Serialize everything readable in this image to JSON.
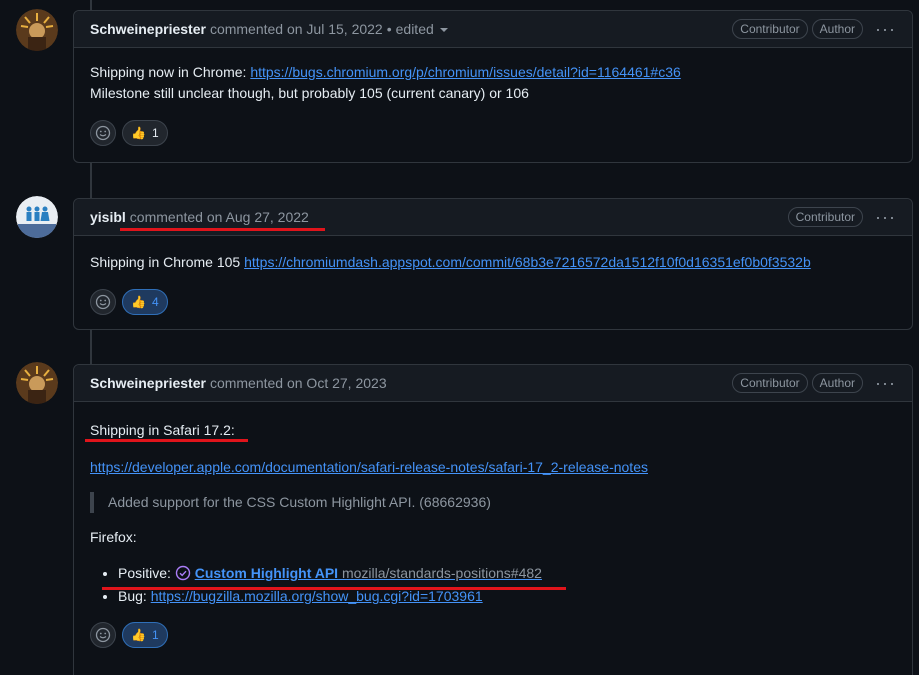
{
  "comments": [
    {
      "author": "Schweinepriester",
      "action": "commented on Jul 15, 2022",
      "edited": "edited",
      "labels": [
        "Contributor",
        "Author"
      ],
      "lines": [
        {
          "text": "Shipping now in Chrome: ",
          "link": "https://bugs.chromium.org/p/chromium/issues/detail?id=1164461#c36"
        },
        {
          "text": "Milestone still unclear though, but probably 105 (current canary) or 106"
        }
      ],
      "reaction": {
        "emoji": "👍",
        "count": "1"
      }
    },
    {
      "author": "yisibl",
      "action": "commented on Aug 27, 2022",
      "labels": [
        "Contributor"
      ],
      "lines": [
        {
          "text": "Shipping in Chrome 105 ",
          "link": "https://chromiumdash.appspot.com/commit/68b3e7216572da1512f10f0d16351ef0b0f3532b"
        }
      ],
      "reaction": {
        "emoji": "👍",
        "count": "4"
      }
    },
    {
      "author": "Schweinepriester",
      "action": "commented on Oct 27, 2023",
      "labels": [
        "Contributor",
        "Author"
      ],
      "heading": "Shipping in Safari 17.2:",
      "link": "https://developer.apple.com/documentation/safari-release-notes/safari-17_2-release-notes",
      "quote": "Added support for the CSS Custom Highlight API. (68662936)",
      "firefox_label": "Firefox:",
      "items": [
        {
          "prefix": "Positive: ",
          "link_bold": "Custom Highlight API",
          "link_rest": " mozilla/standards-positions#482"
        },
        {
          "prefix": "Bug: ",
          "link": "https://bugzilla.mozilla.org/show_bug.cgi?id=1703961"
        }
      ],
      "reaction": {
        "emoji": "👍",
        "count": "1"
      }
    }
  ],
  "kebab": "···",
  "colors": {
    "accent": "#4493f8",
    "highlight": "#e0141b",
    "background": "#0d1117"
  }
}
